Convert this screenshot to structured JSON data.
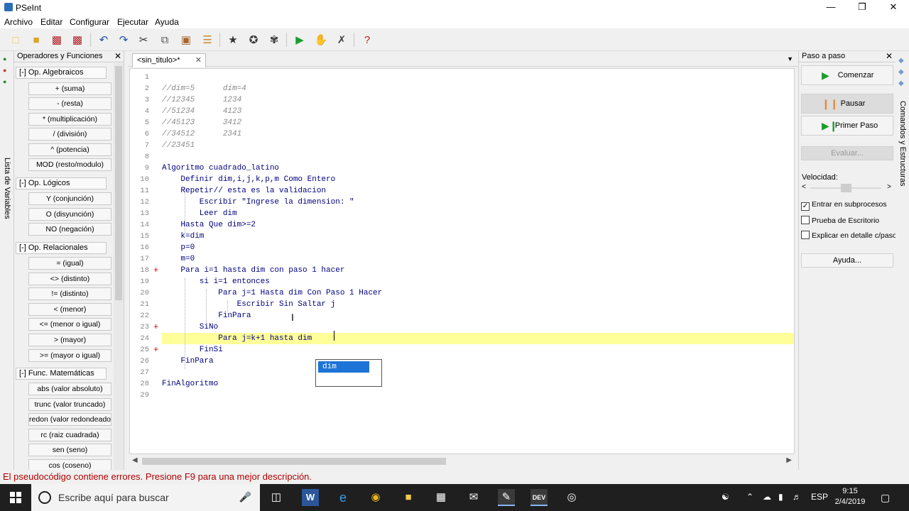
{
  "window": {
    "title": "PSeInt",
    "minimize": "—",
    "maximize": "❐",
    "close": "✕"
  },
  "menu": [
    "Archivo",
    "Editar",
    "Configurar",
    "Ejecutar",
    "Ayuda"
  ],
  "toolbar": {
    "icons": [
      "new-file-icon",
      "open-file-icon",
      "save-icon",
      "save-as-icon",
      "undo-icon",
      "redo-icon",
      "cut-icon",
      "copy-icon",
      "paste-icon",
      "find-icon",
      "run-flowchart-icon",
      "step-icon",
      "debug-icon",
      "run-icon",
      "step-by-step-icon",
      "check-icon",
      "help-icon"
    ]
  },
  "left_vtab": {
    "label": "Lista de Variables"
  },
  "operators": {
    "title": "Operadores y Funciones",
    "sections": [
      {
        "label": "[-]  Op. Algebraicos",
        "items": [
          "+ (suma)",
          "- (resta)",
          "* (multiplicación)",
          "/ (división)",
          "^ (potencia)",
          "MOD (resto/modulo)"
        ]
      },
      {
        "label": "[-]  Op. Lógicos",
        "items": [
          "Y (conjunción)",
          "O (disyunción)",
          "NO (negación)"
        ]
      },
      {
        "label": "[-]  Op. Relacionales",
        "items": [
          "= (igual)",
          "<> (distinto)",
          "!= (distinto)",
          "< (menor)",
          "<= (menor o igual)",
          "> (mayor)",
          ">= (mayor o igual)"
        ]
      },
      {
        "label": "[-]  Func. Matemáticas",
        "items": [
          "abs (valor absoluto)",
          "trunc (valor truncado)",
          "redon (valor redondeado)",
          "rc (raiz cuadrada)",
          "sen (seno)",
          "cos (coseno)"
        ]
      }
    ]
  },
  "editor": {
    "tab_label": "<sin_titulo>*",
    "lines": [
      {
        "n": "1",
        "text": "",
        "cls": "c-plain",
        "mark": ""
      },
      {
        "n": "2",
        "text": "//dim=5      dim=4",
        "cls": "c-com",
        "mark": ""
      },
      {
        "n": "3",
        "text": "//12345      1234",
        "cls": "c-com",
        "mark": ""
      },
      {
        "n": "4",
        "text": "//51234      4123",
        "cls": "c-com",
        "mark": ""
      },
      {
        "n": "5",
        "text": "//45123      3412",
        "cls": "c-com",
        "mark": ""
      },
      {
        "n": "6",
        "text": "//34512      2341",
        "cls": "c-com",
        "mark": ""
      },
      {
        "n": "7",
        "text": "//23451",
        "cls": "c-com",
        "mark": ""
      },
      {
        "n": "8",
        "text": "",
        "cls": "c-plain",
        "mark": ""
      },
      {
        "n": "9",
        "text": "Algoritmo cuadrado_latino",
        "cls": "c-kw",
        "mark": ""
      },
      {
        "n": "10",
        "text": "    Definir dim,i,j,k,p,m Como Entero",
        "cls": "c-kw",
        "mark": ""
      },
      {
        "n": "11",
        "text": "    Repetir// esta es la validacion",
        "cls": "c-kw",
        "mark": ""
      },
      {
        "n": "12",
        "text": "        Escribir \"Ingrese la dimension: \"",
        "cls": "c-kw",
        "mark": ""
      },
      {
        "n": "13",
        "text": "        Leer dim",
        "cls": "c-kw",
        "mark": ""
      },
      {
        "n": "14",
        "text": "    Hasta Que dim>=2",
        "cls": "c-kw",
        "mark": ""
      },
      {
        "n": "15",
        "text": "    k=dim",
        "cls": "c-kw",
        "mark": ""
      },
      {
        "n": "16",
        "text": "    p=0",
        "cls": "c-kw",
        "mark": ""
      },
      {
        "n": "17",
        "text": "    m=0",
        "cls": "c-kw",
        "mark": ""
      },
      {
        "n": "18",
        "text": "    Para i=1 hasta dim con paso 1 hacer",
        "cls": "c-kw",
        "mark": "+"
      },
      {
        "n": "19",
        "text": "        si i=1 entonces",
        "cls": "c-kw",
        "mark": ""
      },
      {
        "n": "20",
        "text": "            Para j=1 Hasta dim Con Paso 1 Hacer",
        "cls": "c-kw",
        "mark": ""
      },
      {
        "n": "21",
        "text": "                Escribir Sin Saltar j",
        "cls": "c-kw",
        "mark": ""
      },
      {
        "n": "22",
        "text": "            FinPara",
        "cls": "c-kw",
        "mark": ""
      },
      {
        "n": "23",
        "text": "        SiNo",
        "cls": "c-kw",
        "mark": "+"
      },
      {
        "n": "24",
        "text": "            Para j=k+1 hasta dim",
        "cls": "c-kw",
        "mark": ""
      },
      {
        "n": "25",
        "text": "        FinSi",
        "cls": "c-kw",
        "mark": "+"
      },
      {
        "n": "26",
        "text": "    FinPara",
        "cls": "c-kw",
        "mark": ""
      },
      {
        "n": "27",
        "text": "",
        "cls": "c-plain",
        "mark": ""
      },
      {
        "n": "28",
        "text": "FinAlgoritmo",
        "cls": "c-kw",
        "mark": ""
      },
      {
        "n": "29",
        "text": "",
        "cls": "c-plain",
        "mark": ""
      }
    ],
    "highlighted_line": "24",
    "autocomplete": [
      "dim"
    ]
  },
  "step_panel": {
    "title": "Paso a paso",
    "start": "Comenzar",
    "pause": "Pausar",
    "first_step": "Primer Paso",
    "evaluate": "Evaluar...",
    "speed_label": "Velocidad:",
    "speed_level": 0.5,
    "options": [
      {
        "label": "Entrar en subprocesos",
        "checked": true
      },
      {
        "label": "Prueba de Escritorio",
        "checked": false
      },
      {
        "label": "Explicar en detalle c/paso",
        "checked": false
      }
    ],
    "help": "Ayuda..."
  },
  "right_vtab": {
    "label": "Comandos y Estructuras"
  },
  "status": "El pseudocódigo contiene errores. Presione F9 para una mejor descripción.",
  "taskbar": {
    "search_placeholder": "Escribe aquí para buscar",
    "apps": [
      "task-view-icon",
      "word-icon",
      "edge-icon",
      "chrome-icon",
      "file-explorer-icon",
      "store-icon",
      "mail-icon",
      "pseint-icon",
      "devcpp-icon",
      "obs-icon"
    ],
    "language": "ESP",
    "time": "9:15",
    "date": "2/4/2019"
  }
}
